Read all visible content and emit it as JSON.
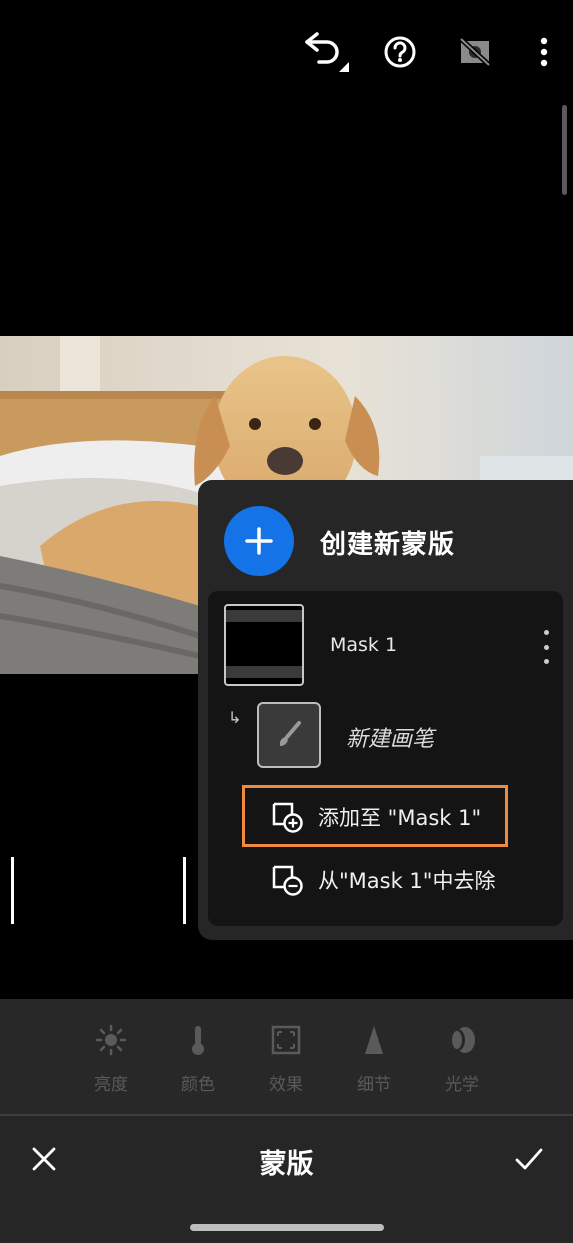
{
  "toolbar": {
    "icons": [
      "undo-icon",
      "help-icon",
      "hide-overlay-icon",
      "more-vertical-icon"
    ]
  },
  "mask_panel": {
    "create_label": "创建新蒙版",
    "mask": {
      "name": "Mask 1"
    },
    "component": {
      "label": "新建画笔"
    },
    "actions": [
      {
        "label": "添加至 \"Mask 1\"",
        "icon": "add-to-mask-icon",
        "highlighted": true
      },
      {
        "label": "从\"Mask 1\"中去除",
        "icon": "subtract-from-mask-icon",
        "highlighted": false
      }
    ],
    "accent_color": "#1473e6",
    "highlight_color": "#f08a3c"
  },
  "tools": [
    {
      "label": "亮度",
      "icon": "sun-icon"
    },
    {
      "label": "颜色",
      "icon": "thermometer-icon"
    },
    {
      "label": "效果",
      "icon": "effects-frame-icon"
    },
    {
      "label": "细节",
      "icon": "triangle-icon"
    },
    {
      "label": "光学",
      "icon": "lens-icon"
    }
  ],
  "bottom_bar": {
    "title": "蒙版",
    "cancel_icon": "close-icon",
    "confirm_icon": "check-icon"
  }
}
